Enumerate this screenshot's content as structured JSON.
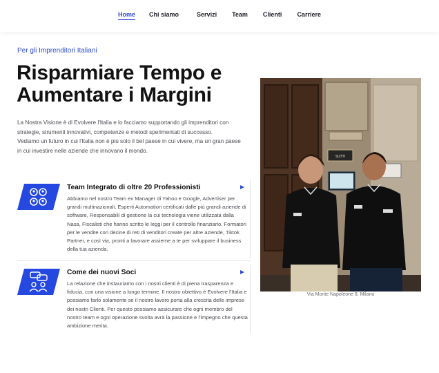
{
  "nav": {
    "items": [
      {
        "label": "Home",
        "active": true
      },
      {
        "label": "Chi siamo",
        "active": false
      },
      {
        "label": "Servizi",
        "active": false
      },
      {
        "label": "Team",
        "active": false
      },
      {
        "label": "Clienti",
        "active": false
      },
      {
        "label": "Carriere",
        "active": false
      }
    ]
  },
  "hero": {
    "eyebrow": "Per gli Imprenditori Italiani",
    "title": "Risparmiare Tempo e Aumentare i Margini",
    "intro_1": "La Nostra Visione è di Evolvere l'Italia e lo facciamo supportando gli imprenditori con strategie, strumenti innovativi, competenze e metodi sperimentati di successo.",
    "intro_2": "Vediamo un futuro in cui l'Italia non è più solo il bel paese in cui vivere, ma un gran paese in cui investire nelle aziende che innovano il mondo."
  },
  "features": [
    {
      "title": "Team Integrato di oltre 20 Professionisti",
      "icon": "team-circles-icon",
      "text": "Abbiamo nel nostro Team ex Manager di Yahoo e Google, Advertiser per grandi multinazionali, Esperti Automation certificati dalle più grandi aziende di software, Responsabili di gestione la cui tecnologia viene utilizzata dalla Nasa, Fiscalisti che hanno scritto le leggi per il controllo finanziario, Formatori per le vendite con decine di reti di venditori create per altre aziende, Tiktok Partner, e così via, pronti a lavorare assieme a te per sviluppare il business della tua azienda."
    },
    {
      "title": "Come dei nuovi Soci",
      "icon": "partners-chat-icon",
      "text": "La relazione che instauriamo con i nostri clienti è di piena trasparenza e fiducia, con una visione a lungo termine. Il nostro obiettivo è Evolvere l'Italia e possiamo farlo solamente se il nostro lavoro porta alla crescita delle imprese dei nostri Clienti. Per questo possiamo assicurare che ogni membro del nostro team e ogni operazione svolta avrà la passione e l'impegno che questa ambizione merita."
    }
  ],
  "photo": {
    "caption": "Via Monte Napoleone 8, Milano",
    "sign_text": "SUTTI"
  },
  "colors": {
    "accent": "#2f4bd8",
    "badge": "#2548e0"
  }
}
